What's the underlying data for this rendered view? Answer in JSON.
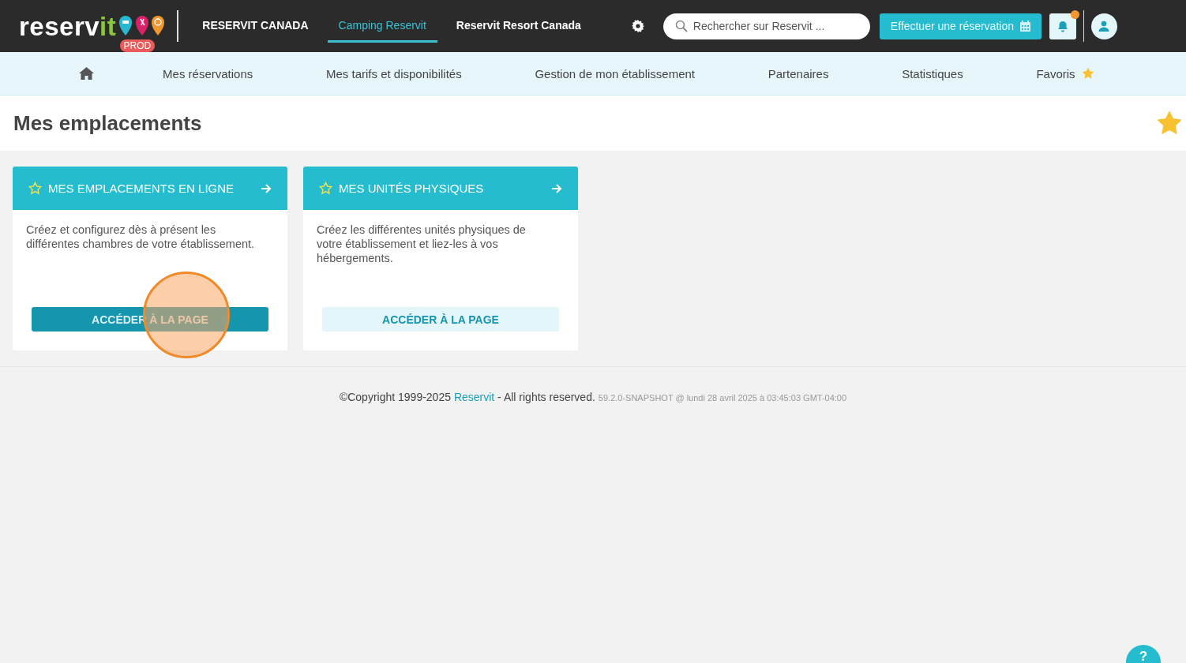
{
  "header": {
    "logo": {
      "parts": [
        "reserv",
        "it"
      ]
    },
    "env_badge": "PROD",
    "tabs": [
      {
        "label": "RESERVIT CANADA",
        "selected": false
      },
      {
        "label": "Camping Reservit",
        "selected": true
      },
      {
        "label": "Reservit Resort Canada",
        "selected": false
      }
    ],
    "search": {
      "placeholder": "Rechercher sur Reservit ..."
    },
    "booking_button": "Effectuer une réservation",
    "notifications": {
      "unread": true
    }
  },
  "menu": {
    "items": [
      "Mes réservations",
      "Mes tarifs et disponibilités",
      "Gestion de mon établissement",
      "Partenaires",
      "Statistiques"
    ],
    "favorites": "Favoris"
  },
  "page": {
    "title": "Mes emplacements",
    "favorite": true
  },
  "cards": [
    {
      "title": "MES EMPLACEMENTS EN LIGNE",
      "description": "Créez et configurez dès à présent les différentes chambres de votre établissement.",
      "button": "ACCÉDER À LA PAGE",
      "kind": "primary",
      "favorite": false,
      "click_marker": true
    },
    {
      "title": "MES UNITÉS PHYSIQUES",
      "description": "Créez les différentes unités physiques de votre établissement et liez-les à vos hébergements.",
      "button": "ACCÉDER À LA PAGE",
      "kind": "light",
      "favorite": false,
      "click_marker": false
    }
  ],
  "footer": {
    "copyright": "©Copyright 1999-2025",
    "link": "Reservit",
    "rights": "- All rights reserved.",
    "version": "59.2.0-SNAPSHOT @ lundi 28 avril 2025 à 03:45:03 GMT-04:00"
  },
  "help_button": "?"
}
